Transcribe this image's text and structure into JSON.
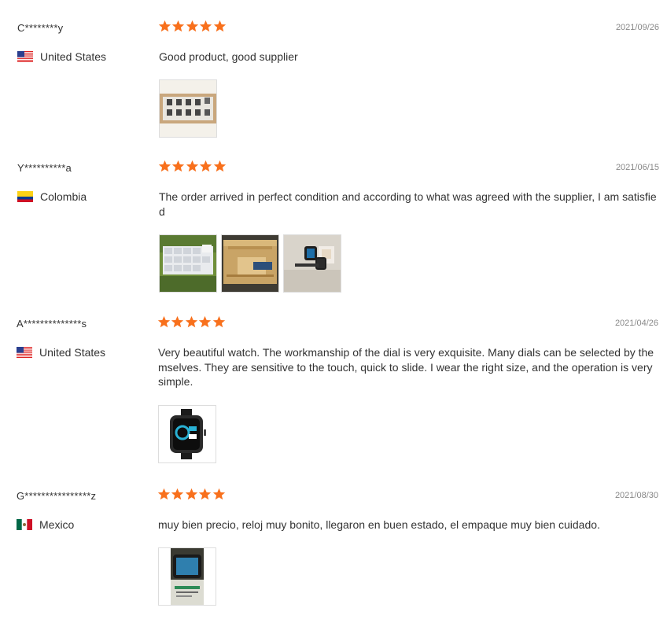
{
  "reviews": [
    {
      "name": "C********y",
      "country": "United States",
      "flag": "us-flag",
      "rating": 5,
      "date": "2021/09/26",
      "text": "Good product, good supplier"
    },
    {
      "name": "Y**********a",
      "country": "Colombia",
      "flag": "colombia-flag",
      "rating": 5,
      "date": "2021/06/15",
      "text": "The order arrived in perfect condition and according to what was agreed with the supplier, I am satisfied"
    },
    {
      "name": "A**************s",
      "country": "United States",
      "flag": "us-flag",
      "rating": 5,
      "date": "2021/04/26",
      "text": "Very beautiful watch. The workmanship of the dial is very exquisite. Many dials can be selected by themselves. They are sensitive to the touch, quick to slide. I wear the right size, and the operation is very simple."
    },
    {
      "name": "G****************z",
      "country": "Mexico",
      "flag": "mexico-flag",
      "rating": 5,
      "date": "2021/08/30",
      "text": "muy bien precio, reloj muy bonito, llegaron en buen estado, el empaque muy bien cuidado."
    }
  ],
  "colors": {
    "star": "#f8701c",
    "text": "#333333",
    "date": "#888888",
    "border": "#dddddd"
  }
}
